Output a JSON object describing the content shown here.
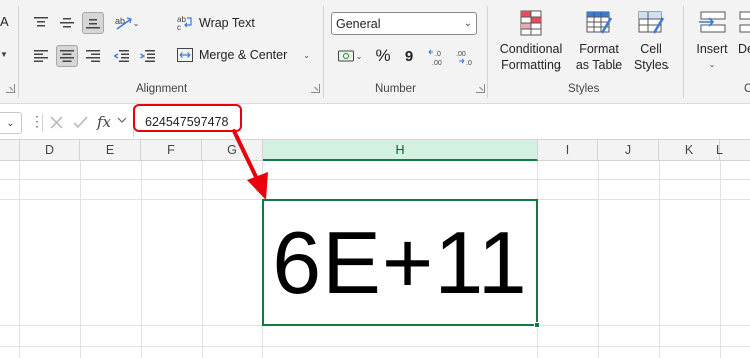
{
  "ribbon": {
    "alignment": {
      "label": "Alignment",
      "wrap_text": "Wrap Text",
      "merge_center": "Merge & Center"
    },
    "number": {
      "label": "Number",
      "format_value": "General",
      "currency_symbol": "$",
      "percent_symbol": "%",
      "comma_symbol": "9",
      "increase_decimal": "←.0 .00",
      "decrease_decimal": ".00 →.0"
    },
    "styles": {
      "label": "Styles",
      "conditional_formatting": "Conditional Formatting",
      "format_as_table": "Format as Table",
      "cell_styles": "Cell Styles"
    },
    "cells": {
      "insert": "Insert",
      "delete_partial": "De",
      "group_partial": "C"
    },
    "edge_letter": "A"
  },
  "formula_bar": {
    "fx_label": "fx",
    "value": "624547597478"
  },
  "columns": [
    "D",
    "E",
    "F",
    "G",
    "H",
    "I",
    "J",
    "K",
    "L"
  ],
  "active_column": "H",
  "active_cell": {
    "display_value": "6E+11"
  },
  "colors": {
    "accent_green": "#107c41",
    "highlight_red": "#e8000b"
  }
}
